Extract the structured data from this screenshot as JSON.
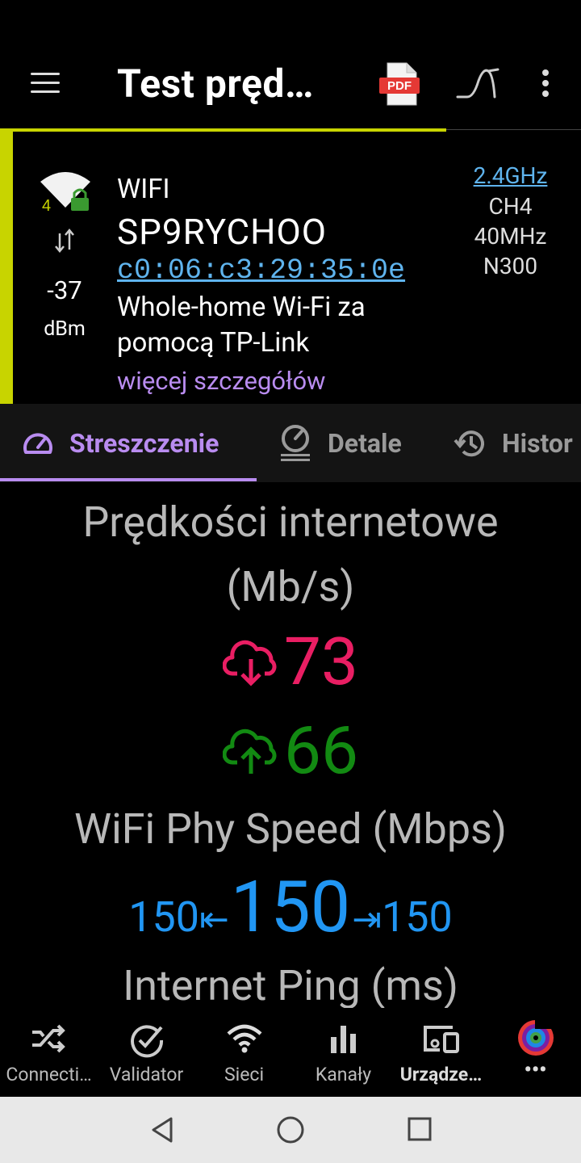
{
  "appbar": {
    "title": "Test pręd…",
    "menu_icon": "hamburger-icon",
    "pdf_icon": "pdf-icon",
    "pdf_label": "PDF",
    "chart_icon": "signal-curve-icon",
    "overflow_icon": "more-vert-icon"
  },
  "network": {
    "type": "WIFI",
    "ssid": "SP9RYCHOO",
    "bssid": "c0:06:c3:29:35:0e",
    "vendor": "Whole-home Wi-Fi za pomocą TP-Link",
    "more_details": "więcej szczegółów",
    "signal_value": "-37",
    "signal_unit": "dBm",
    "wifi_generation_badge": "4",
    "band": "2.4GHz",
    "channel": "CH4",
    "channel_width": "40MHz",
    "standard": "N300",
    "accent_color": "#c8d400"
  },
  "tabs": [
    {
      "label": "Streszczenie",
      "icon": "speedometer-icon",
      "active": true
    },
    {
      "label": "Detale",
      "icon": "gauge-list-icon",
      "active": false
    },
    {
      "label": "Histor",
      "icon": "history-icon",
      "active": false
    }
  ],
  "summary": {
    "internet_title_line1": "Prędkości internetowe",
    "internet_title_line2": "(Mb/s)",
    "download": "73",
    "upload": "66",
    "phy_title": "WiFi Phy Speed (Mbps)",
    "phy_rx": "150",
    "phy_main": "150",
    "phy_tx": "150",
    "ping_title": "Internet Ping (ms)",
    "colors": {
      "download": "#e91e63",
      "upload": "#128a12",
      "phy": "#2196f3"
    }
  },
  "bottom_nav": [
    {
      "label": "Connecti…",
      "icon": "shuffle-icon"
    },
    {
      "label": "Validator",
      "icon": "check-circle-icon"
    },
    {
      "label": "Sieci",
      "icon": "wifi-icon"
    },
    {
      "label": "Kanały",
      "icon": "bar-chart-icon"
    },
    {
      "label": "Urządze…",
      "icon": "devices-icon",
      "active": true
    },
    {
      "label": "•••",
      "icon": "color-ring-icon"
    }
  ],
  "system_nav": {
    "back_icon": "back-triangle-icon",
    "home_icon": "home-circle-icon",
    "recents_icon": "recents-square-icon"
  }
}
